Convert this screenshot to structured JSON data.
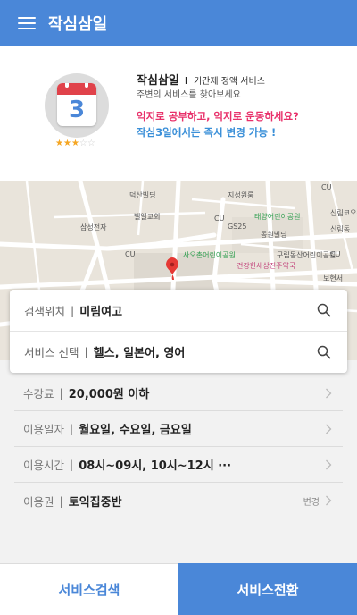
{
  "header": {
    "title": "작심삼일"
  },
  "card": {
    "icon_number": "3",
    "rating": 3,
    "rating_max": 5,
    "title": "작심삼일",
    "separator": "I",
    "subtitle": "기간제 정액 서비스",
    "description": "주변의 서비스를 찾아보세요",
    "promo_line1": "억지로 공부하고, 억지로 운동하세요?",
    "promo_line2": "작심3일에서는 즉시 변경 가능 !",
    "colors": {
      "pink": "#e8306a",
      "blue": "#3a8fd8",
      "calendar_red": "#e0424a"
    }
  },
  "map": {
    "labels": [
      "덕산빌딩",
      "지성원룸",
      "CU",
      "신림코오롱",
      "벨엘교회",
      "태양어린이공원",
      "CU",
      "신림동",
      "삼성전자",
      "GS25",
      "동원빌딩",
      "CU",
      "사오촌어린이공원",
      "구립동산어린이공원",
      "건강한세상진주약국",
      "CU",
      "보현서"
    ],
    "marker_color": "#e53935"
  },
  "search": {
    "location": {
      "label": "검색위치",
      "value": "미림여고"
    },
    "service": {
      "label": "서비스 선택",
      "value": "헬스, 일본어, 영어"
    }
  },
  "info": [
    {
      "label": "수강료",
      "value": "20,000원 이하"
    },
    {
      "label": "이용일자",
      "value": "월요일, 수요일, 금요일"
    },
    {
      "label": "이용시간",
      "value": "08시~09시, 10시~12시 ···"
    },
    {
      "label": "이용권",
      "value": "토익집중반",
      "action": "변경"
    }
  ],
  "buttons": {
    "search": "서비스검색",
    "switch": "서비스전환"
  },
  "colors": {
    "primary": "#4a87d8"
  }
}
